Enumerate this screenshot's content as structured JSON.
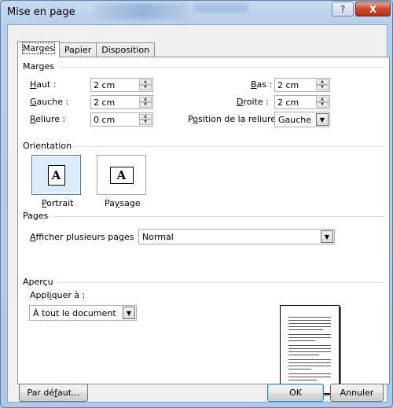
{
  "window": {
    "title": "Mise en page",
    "help_glyph": "?",
    "close_glyph": "X"
  },
  "tabs": [
    {
      "label": "Marges",
      "active": true
    },
    {
      "label": "Papier",
      "active": false
    },
    {
      "label": "Disposition",
      "active": false
    }
  ],
  "margins": {
    "section_label": "Marges",
    "haut": {
      "label_pre": "",
      "label_key": "H",
      "label_post": "aut :",
      "value": "2 cm"
    },
    "gauche": {
      "label_pre": "",
      "label_key": "G",
      "label_post": "auche :",
      "value": "2 cm"
    },
    "reliure": {
      "label_pre": "",
      "label_key": "R",
      "label_post": "eliure :",
      "value": "0 cm"
    },
    "bas": {
      "label_pre": "",
      "label_key": "B",
      "label_post": "as :",
      "value": "2 cm"
    },
    "droite": {
      "label_pre": "",
      "label_key": "D",
      "label_post": "roite :",
      "value": "2 cm"
    },
    "position_reliure": {
      "label_pre": "P",
      "label_key": "o",
      "label_post": "sition de la reliure",
      "value": "Gauche"
    }
  },
  "orientation": {
    "section_label": "Orientation",
    "portrait": {
      "label_pre": "",
      "label_key": "P",
      "label_post": "ortrait",
      "icon_letter": "A",
      "selected": true
    },
    "paysage": {
      "label_pre": "Pa",
      "label_key": "y",
      "label_post": "sage",
      "icon_letter": "A",
      "selected": false
    }
  },
  "pages": {
    "section_label": "Pages",
    "multiple": {
      "label_pre": "",
      "label_key": "A",
      "label_post": "fficher plusieurs pages",
      "value": "Normal"
    }
  },
  "preview": {
    "section_label": "Aperçu",
    "apply_label_pre": "Appl",
    "apply_label_key": "i",
    "apply_label_post": "quer à :",
    "apply_value": "À tout le document"
  },
  "buttons": {
    "default_pre": "Par dé",
    "default_key": "f",
    "default_post": "aut...",
    "ok": "OK",
    "cancel": "Annuler"
  },
  "colors": {
    "titlebar": "#b6cfec",
    "close": "#c6482f",
    "selection": "#dcecfc"
  },
  "icons": [
    "help-icon",
    "close-icon",
    "spin-up-icon",
    "spin-down-icon",
    "dropdown-arrow-icon",
    "portrait-page-icon",
    "landscape-page-icon"
  ]
}
